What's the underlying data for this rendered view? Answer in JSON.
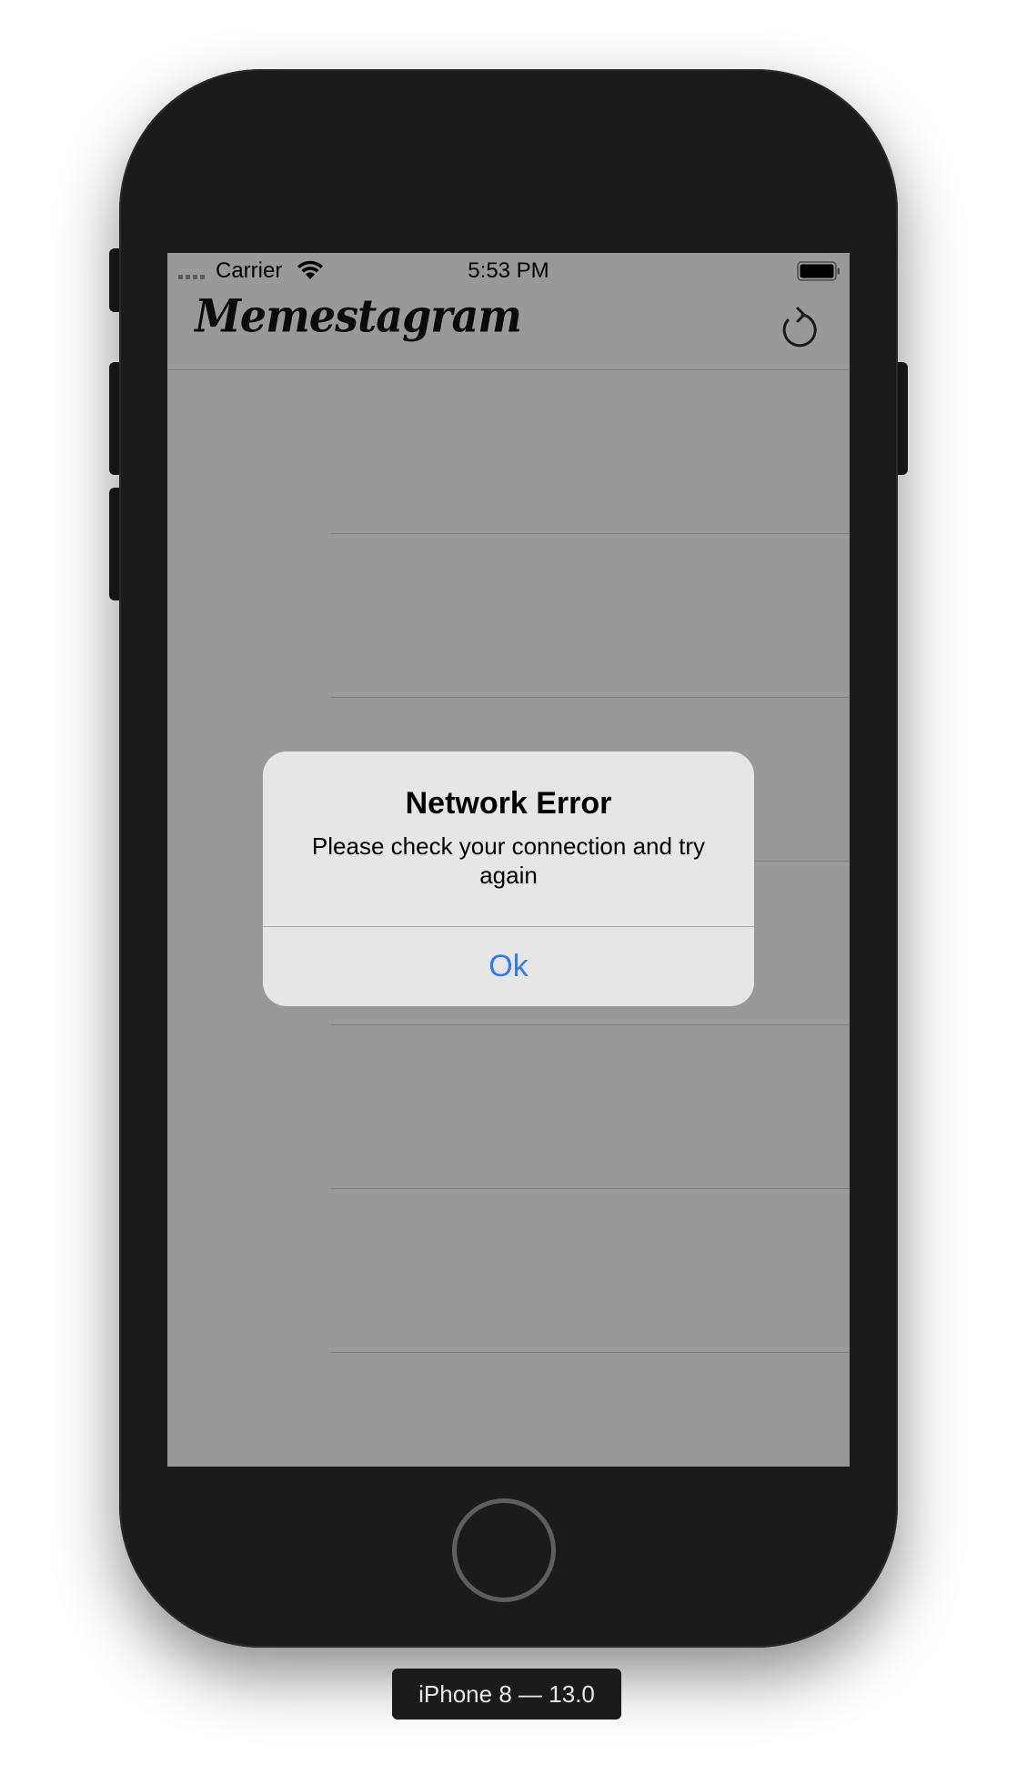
{
  "status_bar": {
    "carrier": "Carrier",
    "time": "5:53 PM",
    "wifi_icon": "wifi-icon",
    "battery_icon": "battery-full-icon"
  },
  "nav_bar": {
    "title": "Memestagram",
    "refresh_icon": "refresh-icon"
  },
  "alert": {
    "title": "Network Error",
    "message": "Please check your connection and try again",
    "ok_label": "Ok",
    "accent_color": "#2f7cf6"
  },
  "device": {
    "label": "iPhone 8 — 13.0"
  },
  "colors": {
    "phone_body": "#1b1b1b",
    "dimmed_screen": "#999999",
    "alert_background": "#e6e6e6"
  }
}
